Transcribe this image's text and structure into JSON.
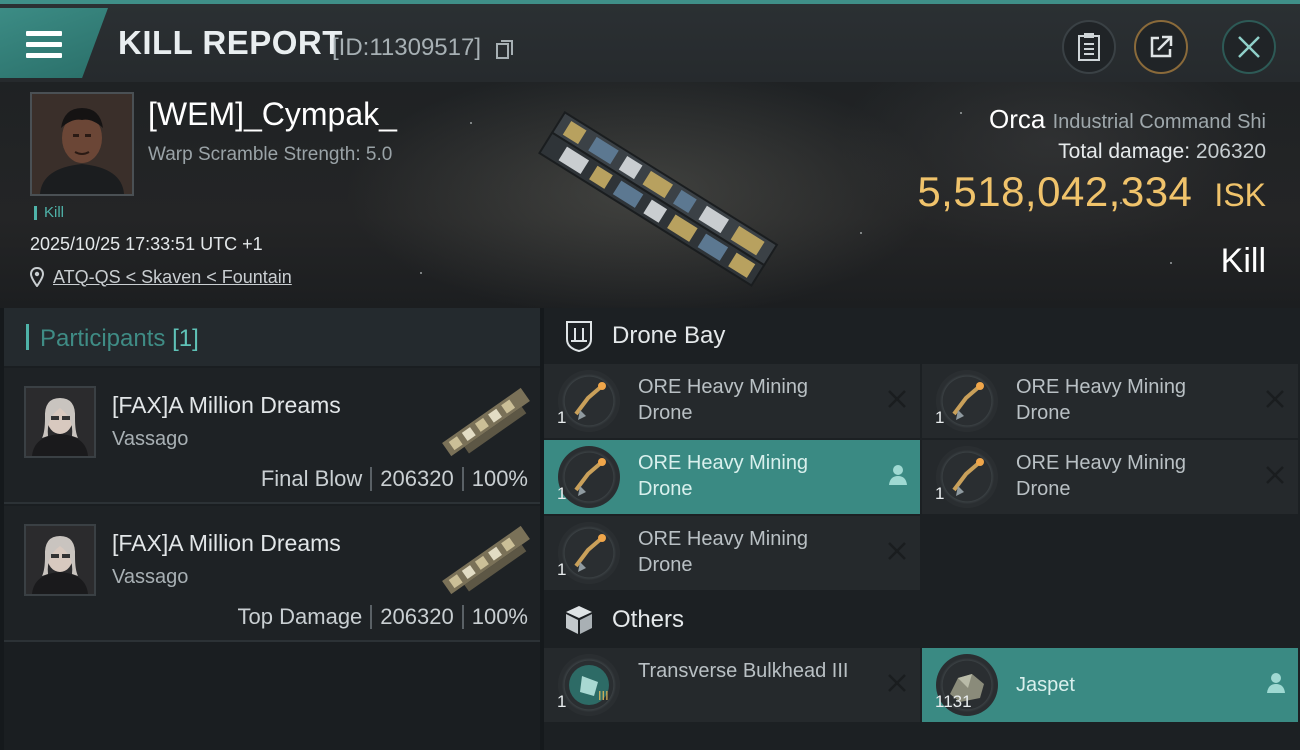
{
  "header": {
    "title": "KILL REPORT",
    "report_id": "[ID:11309517]"
  },
  "victim": {
    "name": "[WEM]_Cympak_",
    "scramble": "Warp Scramble Strength: 5.0",
    "tag": "Kill",
    "datetime": "2025/10/25 17:33:51 UTC +1",
    "location": "ATQ-QS < Skaven < Fountain"
  },
  "ship": {
    "name": "Orca",
    "class": "Industrial Command Shi",
    "total_damage_label": "Total damage:",
    "total_damage_value": "206320",
    "isk_value": "5,518,042,334",
    "isk_unit": "ISK",
    "result": "Kill"
  },
  "participants": {
    "title": "Participants",
    "count": "[1]",
    "rows": [
      {
        "name": "[FAX]A Million Dreams",
        "ship": "Vassago",
        "role": "Final Blow",
        "damage": "206320",
        "percent": "100%"
      },
      {
        "name": "[FAX]A Million Dreams",
        "ship": "Vassago",
        "role": "Top Damage",
        "damage": "206320",
        "percent": "100%"
      }
    ]
  },
  "drone_bay": {
    "title": "Drone Bay",
    "items": [
      {
        "name": "ORE Heavy Mining Drone",
        "qty": "1",
        "state": "destroyed"
      },
      {
        "name": "ORE Heavy Mining Drone",
        "qty": "1",
        "state": "destroyed"
      },
      {
        "name": "ORE Heavy Mining Drone",
        "qty": "1",
        "state": "dropped"
      },
      {
        "name": "ORE Heavy Mining Drone",
        "qty": "1",
        "state": "destroyed"
      },
      {
        "name": "ORE Heavy Mining Drone",
        "qty": "1",
        "state": "destroyed"
      }
    ]
  },
  "others": {
    "title": "Others",
    "items": [
      {
        "name": "Transverse Bulkhead III",
        "qty": "1",
        "state": "destroyed"
      },
      {
        "name": "Jaspet",
        "qty": "1131",
        "state": "dropped"
      }
    ]
  },
  "colors": {
    "accent": "#3f8f88",
    "isk": "#f0c36b",
    "dropped_bg": "#3a8a83"
  }
}
